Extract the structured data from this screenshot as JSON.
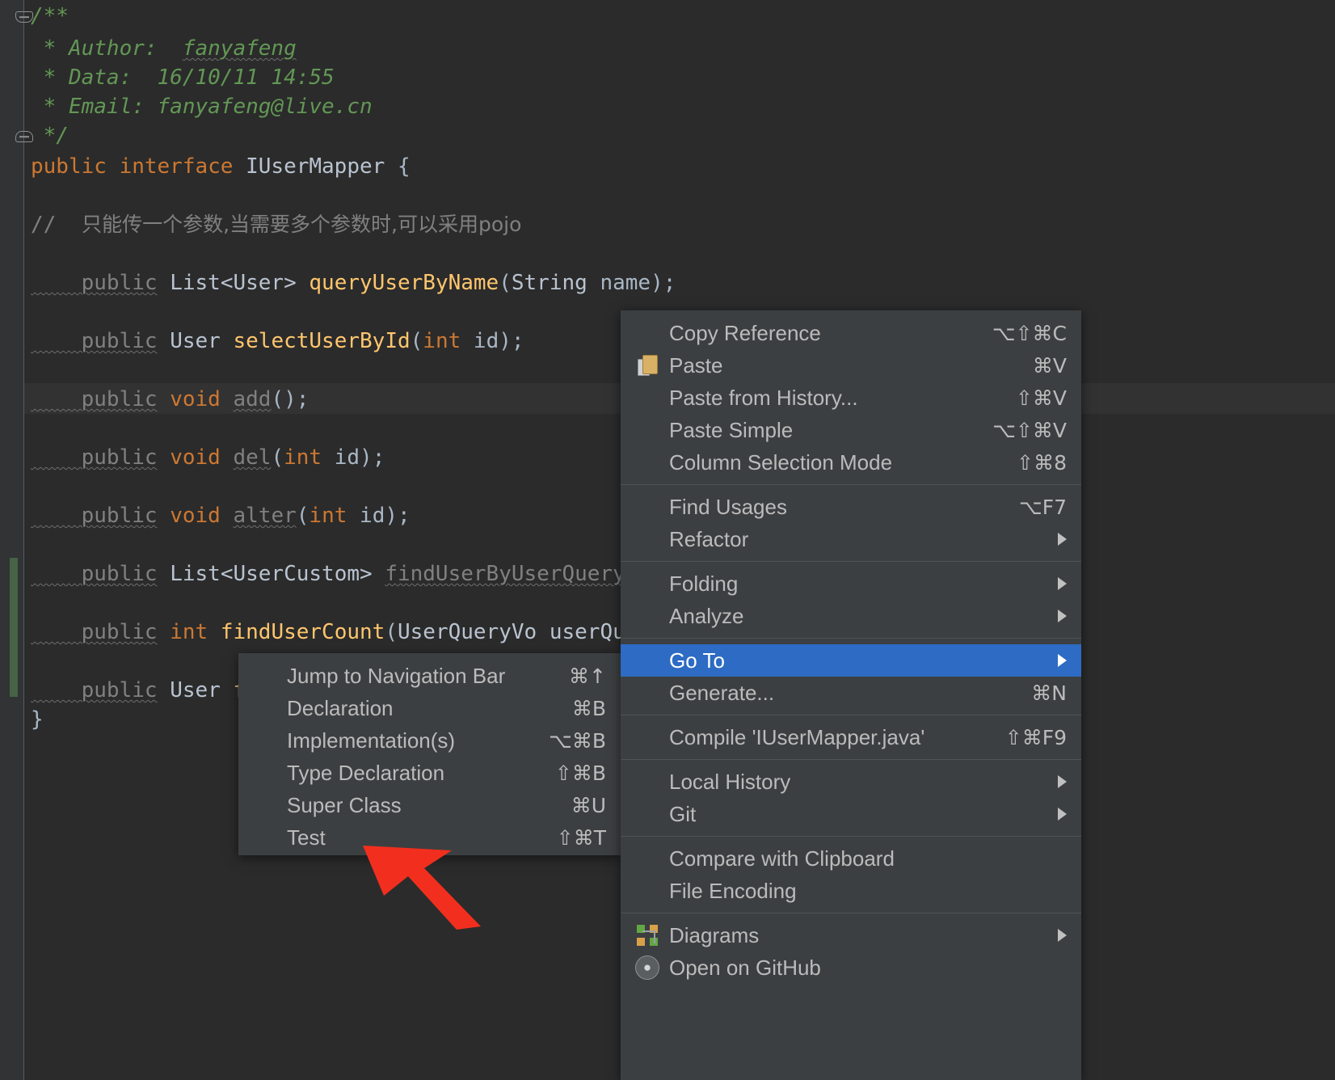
{
  "editor": {
    "filename": "IUserMapper.java",
    "lines": [
      {
        "type": "comment",
        "text": "/**"
      },
      {
        "type": "comment",
        "text": " * Author:  fanyafeng",
        "underline_word": "fanyafeng"
      },
      {
        "type": "comment",
        "text": " * Data:  16/10/11 14:55"
      },
      {
        "type": "comment",
        "text": " * Email: fanyafeng@live.cn"
      },
      {
        "type": "comment",
        "text": " */"
      },
      {
        "type": "code",
        "text": "public interface IUserMapper {"
      },
      {
        "type": "blank",
        "text": ""
      },
      {
        "type": "comment_cjk",
        "text": "//    只能传一个参数,当需要多个参数时,可以采用pojo"
      },
      {
        "type": "code",
        "text": "    public List<User> queryUserByName(String name);"
      },
      {
        "type": "code",
        "text": "    public User selectUserById(int id);"
      },
      {
        "type": "code",
        "text": "    public void add();"
      },
      {
        "type": "code",
        "text": "    public void del(int id);"
      },
      {
        "type": "code",
        "text": "    public void alter(int id);"
      },
      {
        "type": "code",
        "text": "    public List<UserCustom> findUserByUserQuery(UserQueryVo userQueryVo);"
      },
      {
        "type": "code",
        "text": "    public int findUserCount(UserQueryVo userQueryVo);"
      },
      {
        "type": "code",
        "text": "    public User findUserByIdResultMap(int id);"
      },
      {
        "type": "code",
        "text": "}"
      }
    ],
    "comment_color": "#629755",
    "keyword_color": "#cc7832",
    "method_color": "#ffc66d",
    "text_color": "#a9b7c6",
    "background": "#2b2b2b",
    "gutter_background": "#313335",
    "vcs_change_color": "#4a6b4a"
  },
  "context_menu": {
    "name": "editor-context-menu",
    "background": "#3c3f41",
    "highlight_color": "#2d6bc4",
    "groups": [
      {
        "items": [
          {
            "label": "Copy Reference",
            "shortcut": "⌥⇧⌘C",
            "icon": null,
            "submenu": false,
            "selected": false
          },
          {
            "label": "Paste",
            "shortcut": "⌘V",
            "icon": "paste-icon",
            "submenu": false,
            "selected": false
          },
          {
            "label": "Paste from History...",
            "shortcut": "⇧⌘V",
            "icon": null,
            "submenu": false,
            "selected": false
          },
          {
            "label": "Paste Simple",
            "shortcut": "⌥⇧⌘V",
            "icon": null,
            "submenu": false,
            "selected": false
          },
          {
            "label": "Column Selection Mode",
            "shortcut": "⇧⌘8",
            "icon": null,
            "submenu": false,
            "selected": false
          }
        ]
      },
      {
        "items": [
          {
            "label": "Find Usages",
            "shortcut": "⌥F7",
            "icon": null,
            "submenu": false,
            "selected": false
          },
          {
            "label": "Refactor",
            "shortcut": "",
            "icon": null,
            "submenu": true,
            "selected": false
          }
        ]
      },
      {
        "items": [
          {
            "label": "Folding",
            "shortcut": "",
            "icon": null,
            "submenu": true,
            "selected": false
          },
          {
            "label": "Analyze",
            "shortcut": "",
            "icon": null,
            "submenu": true,
            "selected": false
          }
        ]
      },
      {
        "items": [
          {
            "label": "Go To",
            "shortcut": "",
            "icon": null,
            "submenu": true,
            "selected": true
          },
          {
            "label": "Generate...",
            "shortcut": "⌘N",
            "icon": null,
            "submenu": false,
            "selected": false
          }
        ]
      },
      {
        "items": [
          {
            "label": "Compile 'IUserMapper.java'",
            "shortcut": "⇧⌘F9",
            "icon": null,
            "submenu": false,
            "selected": false
          }
        ]
      },
      {
        "items": [
          {
            "label": "Local History",
            "shortcut": "",
            "icon": null,
            "submenu": true,
            "selected": false
          },
          {
            "label": "Git",
            "shortcut": "",
            "icon": null,
            "submenu": true,
            "selected": false
          }
        ]
      },
      {
        "items": [
          {
            "label": "Compare with Clipboard",
            "shortcut": "",
            "icon": null,
            "submenu": false,
            "selected": false
          },
          {
            "label": "File Encoding",
            "shortcut": "",
            "icon": null,
            "submenu": false,
            "selected": false
          }
        ]
      },
      {
        "items": [
          {
            "label": "Diagrams",
            "shortcut": "",
            "icon": "diagrams-icon",
            "submenu": true,
            "selected": false
          },
          {
            "label": "Open on GitHub",
            "shortcut": "",
            "icon": "github-icon",
            "submenu": false,
            "selected": false
          }
        ]
      }
    ]
  },
  "submenu": {
    "name": "go-to-submenu",
    "items": [
      {
        "label": "Jump to Navigation Bar",
        "shortcut": "⌘↑"
      },
      {
        "label": "Declaration",
        "shortcut": "⌘B"
      },
      {
        "label": "Implementation(s)",
        "shortcut": "⌥⌘B"
      },
      {
        "label": "Type Declaration",
        "shortcut": "⇧⌘B"
      },
      {
        "label": "Super Class",
        "shortcut": "⌘U"
      },
      {
        "label": "Test",
        "shortcut": "⇧⌘T"
      }
    ]
  },
  "annotation": {
    "name": "red-arrow-pointer",
    "color": "#f22f1e",
    "points_to": "Test"
  }
}
